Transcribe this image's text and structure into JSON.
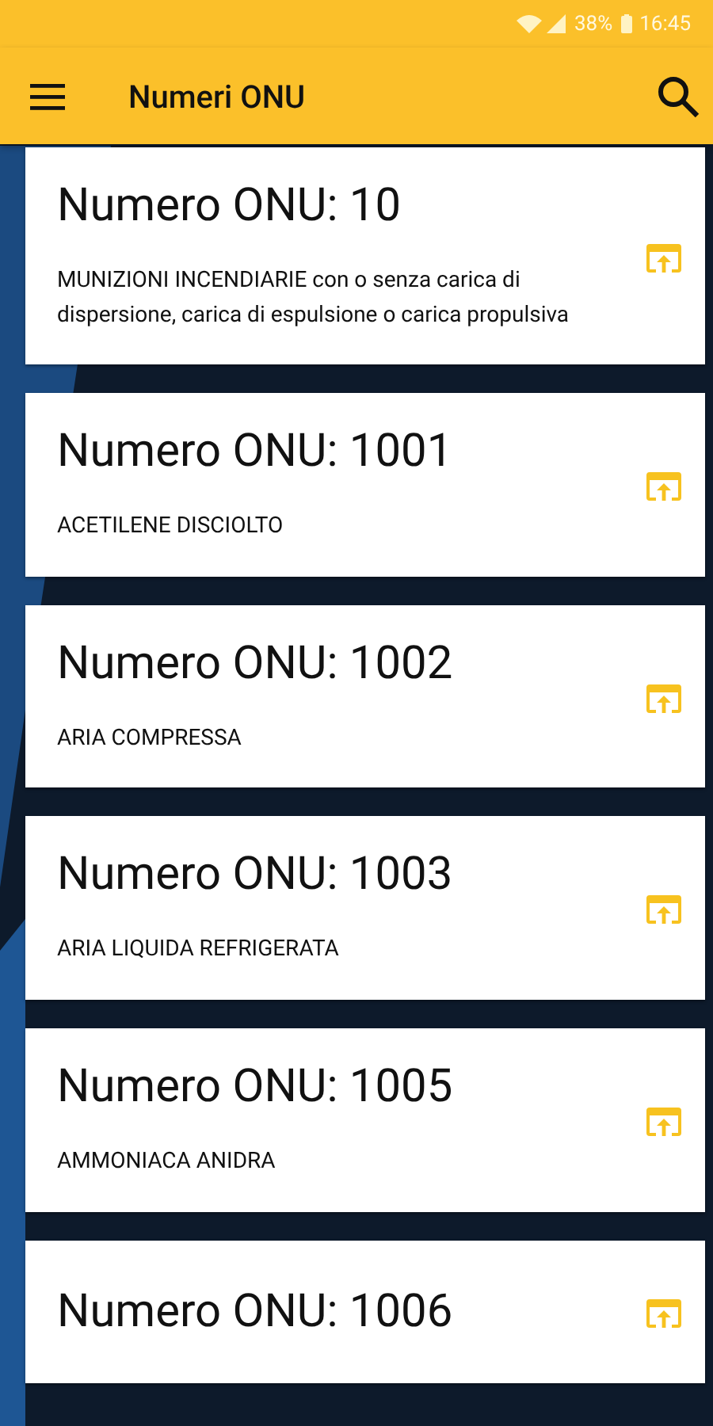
{
  "status_bar": {
    "battery": "38%",
    "time": "16:45"
  },
  "app_bar": {
    "title": "Numeri ONU"
  },
  "items": [
    {
      "title": "Numero ONU: 10",
      "description": "MUNIZIONI INCENDIARIE con o senza carica di dispersione, carica di espulsione o carica propulsiva"
    },
    {
      "title": "Numero ONU: 1001",
      "description": "ACETILENE DISCIOLTO"
    },
    {
      "title": "Numero ONU: 1002",
      "description": "ARIA COMPRESSA"
    },
    {
      "title": "Numero ONU: 1003",
      "description": "ARIA LIQUIDA REFRIGERATA"
    },
    {
      "title": "Numero ONU: 1005",
      "description": "AMMONIACA ANIDRA"
    },
    {
      "title": "Numero ONU: 1006"
    }
  ]
}
